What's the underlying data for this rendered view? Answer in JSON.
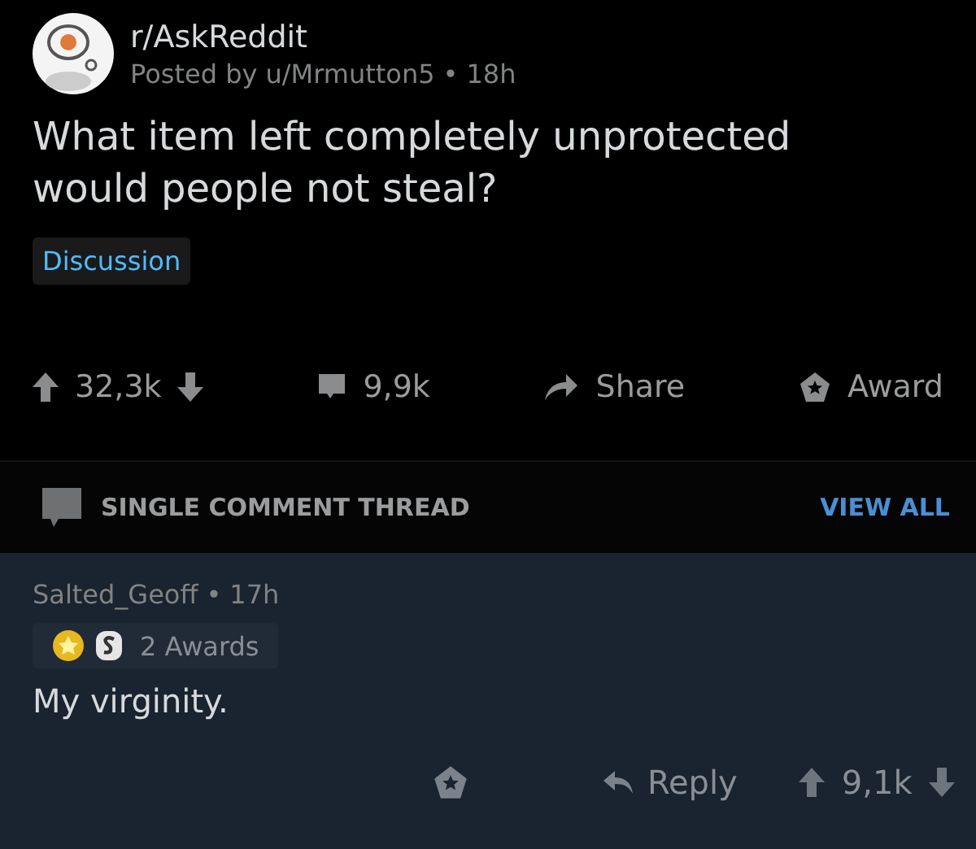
{
  "post": {
    "subreddit": "r/AskReddit",
    "posted_by": "Posted by u/Mrmutton5",
    "separator": "•",
    "age": "18h",
    "title": "What item left completely unprotected would people not steal?",
    "flair": "Discussion",
    "score": "32,3k",
    "comments": "9,9k",
    "share": "Share",
    "award": "Award"
  },
  "thread_bar": {
    "label": "SINGLE COMMENT THREAD",
    "view_all": "VIEW ALL"
  },
  "comment": {
    "author": "Salted_Geoff",
    "separator": "•",
    "age": "17h",
    "awards": "2 Awards",
    "body": "My virginity.",
    "reply": "Reply",
    "score": "9,1k"
  }
}
